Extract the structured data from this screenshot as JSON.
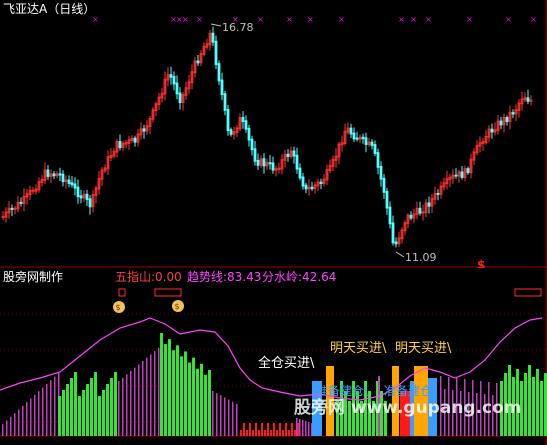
{
  "header": {
    "title": "飞亚达A（日线）",
    "title_color": "#ffffff"
  },
  "price_panel": {
    "high_label": "16.78",
    "low_label": "11.09",
    "marker_glyph": "$",
    "colors": {
      "up": "#ff3232",
      "down": "#54ffff",
      "label": "#c0c0c0",
      "marker": "#ff00ff"
    }
  },
  "indicator_panel": {
    "name": "股旁网制作",
    "metrics": [
      {
        "label": "五指山:",
        "value": "0.00",
        "color": "#ff4040"
      },
      {
        "label": "趋势线:",
        "value": "83.43",
        "color": "#ff44ff"
      },
      {
        "label": "分水岭:",
        "value": "42.64",
        "color": "#ff44ff"
      }
    ],
    "annotations": [
      {
        "text": "全仓买进\\",
        "color": "#ffffff"
      },
      {
        "text": "明天买进\\",
        "color": "#ffd24a"
      },
      {
        "text": "明天买进\\",
        "color": "#ffd24a"
      },
      {
        "text": "准备建仓\\",
        "color": "#3aa0ff"
      },
      {
        "text": "准备建仓\\",
        "color": "#3aa0ff"
      }
    ],
    "watermark": "股旁网 www.gupang.com",
    "colors": {
      "trend": "#ff44ff",
      "bar_green": "#32e632",
      "bar_magenta": "#c040c0",
      "bar_red": "#ff1a1a",
      "bar_orange": "#ffa500",
      "bar_blue": "#3a9cff"
    }
  }
}
